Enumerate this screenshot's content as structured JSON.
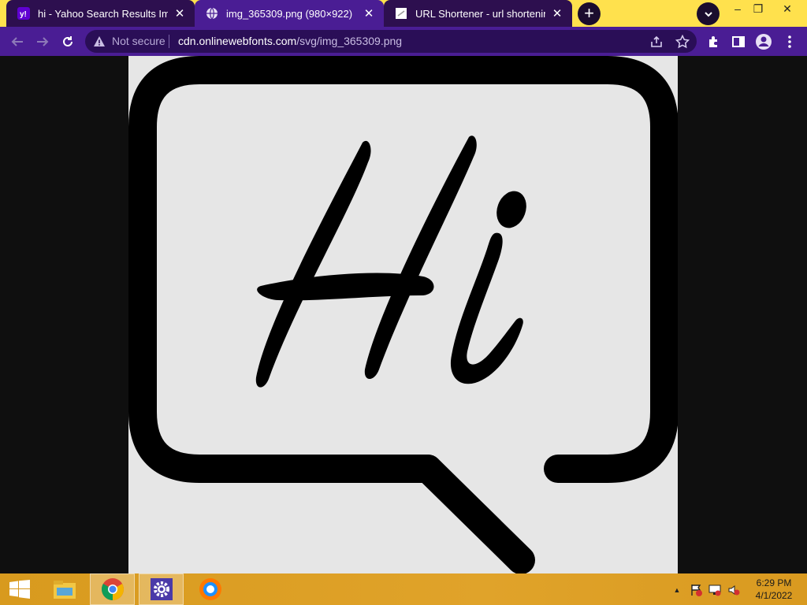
{
  "tabs": [
    {
      "title": "hi - Yahoo Search Results Image",
      "favicon": "yahoo-icon",
      "close": "✕",
      "active": false
    },
    {
      "title": "img_365309.png (980×922)",
      "favicon": "globe-icon",
      "close": "✕",
      "active": true
    },
    {
      "title": "URL Shortener - url shortening se",
      "favicon": "page-icon",
      "close": "✕",
      "active": false
    }
  ],
  "new_tab_label": "+",
  "window_controls": {
    "minimize": "–",
    "restore": "❐",
    "close": "✕"
  },
  "omnibox": {
    "security_label": "Not secure",
    "url_host": "cdn.onlinewebfonts.com",
    "url_path": "/svg/img_365309.png"
  },
  "image": {
    "text": "Hi",
    "description_icon": "speech-bubble-icon"
  },
  "taskbar": {
    "items": [
      "start-button",
      "file-explorer",
      "chrome",
      "settings",
      "avast-browser"
    ],
    "clock_time": "6:29 PM",
    "clock_date": "4/1/2022",
    "tray_arrow": "▲"
  },
  "colors": {
    "titlebar": "#ffe14d",
    "active_tab": "#4a1d94",
    "inactive_tab": "#2d0f4f",
    "toolbar": "#4a1d94",
    "omnibox": "#2a0e57",
    "taskbar": "#dea025",
    "image_bg": "#e6e6e6"
  }
}
